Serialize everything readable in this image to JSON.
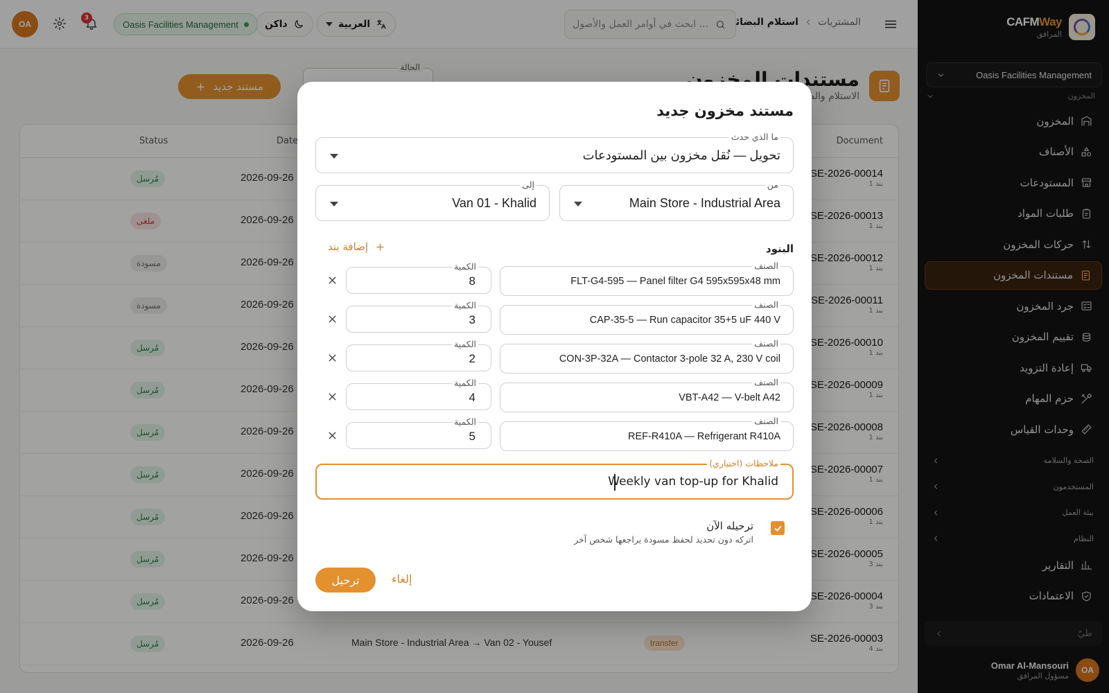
{
  "colors": {
    "accent": "#e3902f",
    "sidebar_bg": "#141414",
    "success": "#2d7b41",
    "danger": "#c43a3a"
  },
  "sidebar": {
    "brand_name_1": "CAFM",
    "brand_name_2": "Way",
    "brand_sub": "المرافق",
    "org_select": "Oasis Facilities Management",
    "group_label": "المخزون",
    "items": [
      {
        "label": "المخزون",
        "icon": "warehouse-icon"
      },
      {
        "label": "الأصناف",
        "icon": "shapes-icon"
      },
      {
        "label": "المستودعات",
        "icon": "store-icon"
      },
      {
        "label": "طلبات المواد",
        "icon": "clipboard-icon"
      },
      {
        "label": "حركات المخزون",
        "icon": "arrows-updown-icon"
      },
      {
        "label": "مستندات المخزون",
        "icon": "receipt-icon",
        "active": true
      },
      {
        "label": "جرد المخزون",
        "icon": "checklist-icon"
      },
      {
        "label": "تقييم المخزون",
        "icon": "coins-icon"
      },
      {
        "label": "إعادة التزويد",
        "icon": "truck-icon"
      },
      {
        "label": "حزم المهام",
        "icon": "tools-icon"
      },
      {
        "label": "وحدات القياس",
        "icon": "ruler-icon"
      }
    ],
    "sections": [
      "الصحة والسلامة",
      "المستخدمون",
      "بيئة العمل",
      "النظام"
    ],
    "bottom_items": [
      {
        "label": "التقارير",
        "icon": "chart-icon"
      },
      {
        "label": "الاعتمادات",
        "icon": "shield-check-icon"
      }
    ],
    "search_placeholder": "طيّ",
    "user": {
      "initials": "OA",
      "name": "Omar Al-Mansouri",
      "role": "مسؤول المرافق"
    }
  },
  "topbar": {
    "breadcrumb_parent": "المشتريات",
    "breadcrumb_current": "استلام البضائع",
    "search_placeholder": "ابحث في أوامر العمل والأصول ...",
    "language": "العربية",
    "theme": "داكن",
    "org_pill": "Oasis Facilities Management",
    "notifications_count": "3",
    "avatar_initials": "OA"
  },
  "page": {
    "title": "مستندات المخزون",
    "subtitle": "الاستلام والصرف والتحويل",
    "status_filter_label": "الحالة",
    "new_button": "مستند جديد"
  },
  "table": {
    "columns": {
      "document": "Document",
      "date": "Date",
      "status": "Status"
    },
    "rows": [
      {
        "doc": "SE-2026-00014",
        "lines": "1 بند",
        "date": "2026-09-26",
        "status": "مُرسل",
        "status_kind": "sent"
      },
      {
        "doc": "SE-2026-00013",
        "lines": "1 بند",
        "date": "2026-09-26",
        "status": "ملغى",
        "status_kind": "void"
      },
      {
        "doc": "SE-2026-00012",
        "lines": "1 بند",
        "date": "2026-09-26",
        "status": "مسودة",
        "status_kind": "draft"
      },
      {
        "doc": "SE-2026-00011",
        "lines": "1 بند",
        "date": "2026-09-26",
        "status": "مسودة",
        "status_kind": "draft"
      },
      {
        "doc": "SE-2026-00010",
        "lines": "1 بند",
        "date": "2026-09-26",
        "status": "مُرسل",
        "status_kind": "sent"
      },
      {
        "doc": "SE-2026-00009",
        "lines": "1 بند",
        "date": "2026-09-26",
        "status": "مُرسل",
        "status_kind": "sent"
      },
      {
        "doc": "SE-2026-00008",
        "lines": "1 بند",
        "date": "2026-09-26",
        "status": "مُرسل",
        "status_kind": "sent"
      },
      {
        "doc": "SE-2026-00007",
        "lines": "1 بند",
        "date": "2026-09-26",
        "status": "مُرسل",
        "status_kind": "sent"
      },
      {
        "doc": "SE-2026-00006",
        "lines": "1 بند",
        "date": "2026-09-26",
        "status": "مُرسل",
        "status_kind": "sent"
      },
      {
        "doc": "SE-2026-00005",
        "lines": "3 بند",
        "date": "2026-09-26",
        "status": "مُرسل",
        "status_kind": "sent"
      },
      {
        "doc": "SE-2026-00004",
        "lines": "3 بند",
        "date": "2026-09-26",
        "status": "مُرسل",
        "status_kind": "sent"
      },
      {
        "doc": "SE-2026-00003",
        "lines": "4 بند",
        "date": "2026-09-26",
        "status": "مُرسل",
        "status_kind": "sent",
        "route": "Main Store - Industrial Area → Van 02 - Yousef",
        "type": "transfer"
      }
    ]
  },
  "modal": {
    "title": "مستند مخزون جديد",
    "what_label": "ما الذي حدث",
    "what_value": "تحويل — نُقل مخزون بين المستودعات",
    "from_label": "من",
    "from_value": "Main Store - Industrial Area",
    "to_label": "إلى",
    "to_value": "Van 01 - Khalid",
    "lines_heading": "البنود",
    "add_line": "إضافة بند",
    "item_label": "الصنف",
    "qty_label": "الكمية",
    "lines": [
      {
        "item": "FLT-G4-595 — Panel filter G4 595x595x48 mm",
        "qty": "8"
      },
      {
        "item": "CAP-35-5 — Run capacitor 35+5 uF 440 V",
        "qty": "3"
      },
      {
        "item": "CON-3P-32A — Contactor 3-pole 32 A, 230 V coil",
        "qty": "2"
      },
      {
        "item": "VBT-A42 — V-belt A42",
        "qty": "4"
      },
      {
        "item": "REF-R410A — Refrigerant R410A",
        "qty": "5"
      }
    ],
    "notes_label": "ملاحظات (اختياري)",
    "notes_value": "Weekly van top-up for Khalid",
    "post_now_title": "ترحيله الآن",
    "post_now_hint": "اتركه دون تحديد لحفظ مسودة يراجعها شخص آخر",
    "post_now_checked": true,
    "cancel_button": "إلغاء",
    "post_button": "ترحيل"
  }
}
